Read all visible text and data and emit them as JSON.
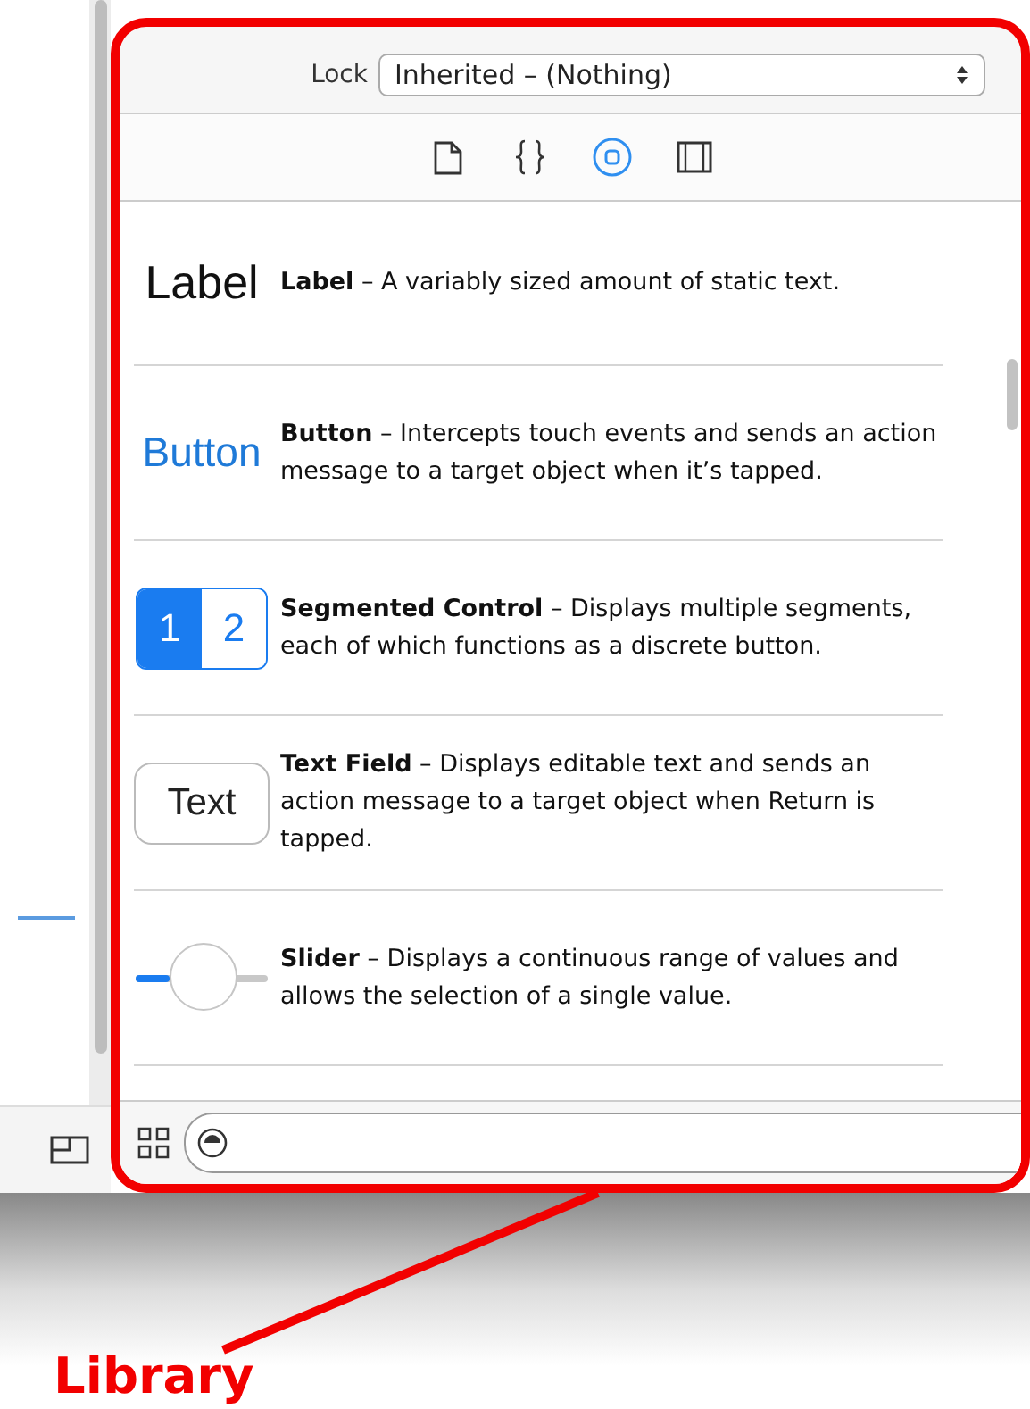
{
  "inspector": {
    "lock_label": "Lock",
    "lock_value": "Inherited – (Nothing)"
  },
  "library_tabs": [
    {
      "kind": "file",
      "selected": false
    },
    {
      "kind": "braces",
      "selected": false
    },
    {
      "kind": "object",
      "selected": true
    },
    {
      "kind": "media",
      "selected": false
    }
  ],
  "library_items": [
    {
      "kind": "label",
      "preview": "Label",
      "description": "**Label** – A variably sized amount of static text."
    },
    {
      "kind": "button",
      "preview": "Button",
      "description": "**Button** – Intercepts touch events and sends an action message to a target object when it’s tapped."
    },
    {
      "kind": "segmented",
      "segments": [
        {
          "label": "1",
          "selected": true
        },
        {
          "label": "2",
          "selected": false
        }
      ],
      "description": "**Segmented Control** – Displays multiple segments, each of which functions as a discrete button."
    },
    {
      "kind": "textfield",
      "preview": "Text",
      "description": "**Text Field** – Displays editable text and sends an action message to a target object when Return is tapped."
    },
    {
      "kind": "slider",
      "level": 0.25,
      "description": "**Slider** – Displays a continuous range of values and allows the selection of a single value."
    }
  ],
  "annotation": {
    "label": "Library"
  }
}
